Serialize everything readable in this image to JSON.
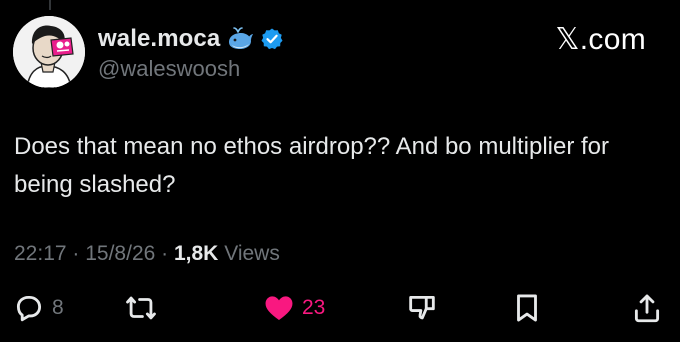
{
  "author": {
    "display_name": "wale.moca",
    "handle": "@waleswoosh",
    "badge_emoji_icon": "whale-icon",
    "verified_icon": "verified-badge-icon"
  },
  "brand": "𝕏.com",
  "tweet": {
    "text": "Does that mean no ethos airdrop?? And bo multiplier for being slashed?"
  },
  "meta": {
    "time": "22:17",
    "date": "15/8/26",
    "views_count": "1,8K",
    "views_label": "Views"
  },
  "actions": {
    "reply_count": "8",
    "like_count": "23"
  },
  "colors": {
    "background": "#000000",
    "text": "#e7e9ea",
    "muted": "#71767b",
    "like": "#f91880",
    "verified": "#1d9bf0"
  }
}
